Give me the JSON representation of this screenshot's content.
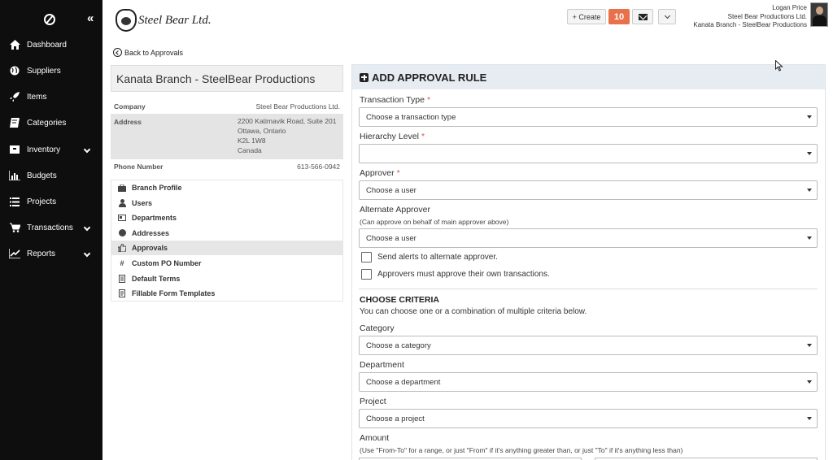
{
  "sidebar": {
    "items": [
      {
        "label": "Dashboard",
        "icon": "home-icon"
      },
      {
        "label": "Suppliers",
        "icon": "globe-icon"
      },
      {
        "label": "Items",
        "icon": "rocket-icon"
      },
      {
        "label": "Categories",
        "icon": "book-icon"
      },
      {
        "label": "Inventory",
        "icon": "inventory-icon"
      },
      {
        "label": "Budgets",
        "icon": "bar-chart-icon"
      },
      {
        "label": "Projects",
        "icon": "list-icon"
      },
      {
        "label": "Transactions",
        "icon": "cart-icon"
      },
      {
        "label": "Reports",
        "icon": "line-chart-icon"
      }
    ]
  },
  "header": {
    "brand": "Steel Bear Ltd.",
    "create_label": "+ Create",
    "notification_count": "10",
    "user_name": "Logan Price",
    "user_company": "Steel Bear Productions Ltd.",
    "user_branch": "Kanata Branch - SteelBear Productions"
  },
  "back_link": "Back to Approvals",
  "branch": {
    "title": "Kanata Branch - SteelBear Productions",
    "company_label": "Company",
    "company_value": "Steel Bear Productions Ltd.",
    "address_label": "Address",
    "address_lines": [
      "2200 Katimavik Road, Suite 201",
      "Ottawa, Ontario",
      "K2L 1W8",
      "Canada"
    ],
    "phone_label": "Phone Number",
    "phone_value": "613-566-0942"
  },
  "branch_nav": [
    {
      "label": "Branch Profile",
      "icon": "briefcase-icon"
    },
    {
      "label": "Users",
      "icon": "user-icon"
    },
    {
      "label": "Departments",
      "icon": "id-card-icon"
    },
    {
      "label": "Addresses",
      "icon": "globe-icon"
    },
    {
      "label": "Approvals",
      "icon": "thumbs-up-icon"
    },
    {
      "label": "Custom PO Number",
      "icon": "hash-icon"
    },
    {
      "label": "Default Terms",
      "icon": "document-icon"
    },
    {
      "label": "Fillable Form Templates",
      "icon": "form-icon"
    }
  ],
  "form": {
    "heading": "ADD APPROVAL RULE",
    "transaction_type_label": "Transaction Type",
    "transaction_type_value": "Choose a transaction type",
    "hierarchy_label": "Hierarchy Level",
    "hierarchy_value": "",
    "approver_label": "Approver",
    "approver_value": "Choose a user",
    "alt_approver_label": "Alternate Approver",
    "alt_approver_note": "(Can approve on behalf of main approver above)",
    "alt_approver_value": "Choose a user",
    "send_alerts_label": "Send alerts to alternate approver.",
    "own_transactions_label": "Approvers must approve their own transactions.",
    "criteria_title": "CHOOSE CRITERIA",
    "criteria_desc": "You can choose one or a combination of multiple criteria below.",
    "category_label": "Category",
    "category_value": "Choose a category",
    "department_label": "Department",
    "department_value": "Choose a department",
    "project_label": "Project",
    "project_value": "Choose a project",
    "amount_label": "Amount",
    "amount_note": "(Use \"From-To\" for a range, or just \"From\" if it's anything greater than, or just \"To\" if it's anything less than)",
    "required_mark": "*"
  }
}
